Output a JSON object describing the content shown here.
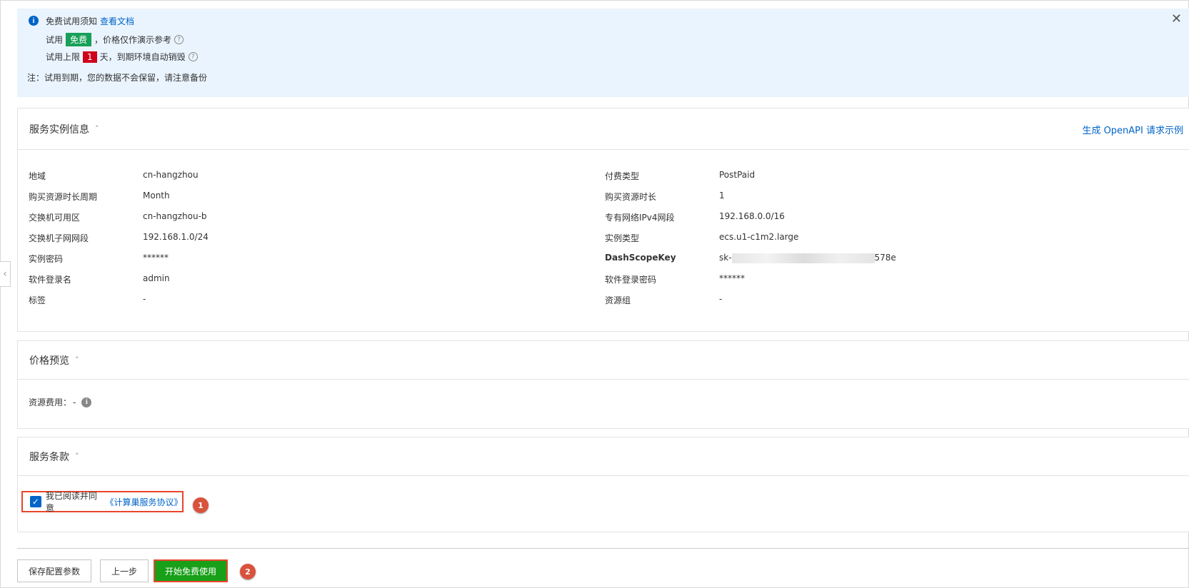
{
  "notice": {
    "title": "免费试用须知",
    "doc_link": "查看文档",
    "line1_prefix": "试用",
    "line1_badge": "免费",
    "line1_suffix": "，价格仅作演示参考",
    "line2_prefix": "试用上限",
    "line2_badge": "1",
    "line2_suffix": "天，到期环境自动销毁",
    "note": "注：试用到期，您的数据不会保留，请注意备份"
  },
  "instance": {
    "title": "服务实例信息",
    "openapi_link": "生成 OpenAPI 请求示例",
    "left": [
      {
        "k": "地域",
        "v": "cn-hangzhou"
      },
      {
        "k": "购买资源时长周期",
        "v": "Month"
      },
      {
        "k": "交换机可用区",
        "v": "cn-hangzhou-b"
      },
      {
        "k": "交换机子网网段",
        "v": "192.168.1.0/24"
      },
      {
        "k": "实例密码",
        "v": "******"
      },
      {
        "k": "软件登录名",
        "v": "admin"
      },
      {
        "k": "标签",
        "v": "-"
      }
    ],
    "right": [
      {
        "k": "付费类型",
        "v": "PostPaid"
      },
      {
        "k": "购买资源时长",
        "v": "1"
      },
      {
        "k": "专有网络IPv4网段",
        "v": "192.168.0.0/16"
      },
      {
        "k": "实例类型",
        "v": "ecs.u1-c1m2.large"
      },
      {
        "k": "DashScopeKey",
        "v_prefix": "sk-",
        "v_suffix": "578e"
      },
      {
        "k": "软件登录密码",
        "v": "******"
      },
      {
        "k": "资源组",
        "v": "-"
      }
    ]
  },
  "price": {
    "title": "价格预览",
    "label": "资源费用：",
    "value": "-"
  },
  "terms": {
    "title": "服务条款",
    "agree_text": "我已阅读并同意",
    "agreement_link": "《计算巢服务协议》",
    "checked": true
  },
  "markers": {
    "m1": "1",
    "m2": "2"
  },
  "buttons": {
    "save": "保存配置参数",
    "prev": "上一步",
    "start": "开始免费使用"
  }
}
